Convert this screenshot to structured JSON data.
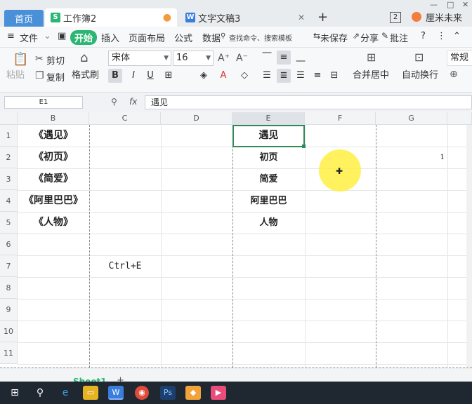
{
  "tabs": {
    "home": "首页",
    "workbook": "工作簿2",
    "workbook_icon": "S",
    "doc": "文字文稿3",
    "doc_icon": "W",
    "new_tab": "+"
  },
  "titlebar": {
    "page_count": "2",
    "user_name": "厘米未来",
    "minimize": "—",
    "restore": "□"
  },
  "menu": {
    "hamburger": "≡",
    "file": "文件",
    "start": "开始",
    "insert": "插入",
    "page_layout": "页面布局",
    "formula": "公式",
    "data": "数据",
    "search": "查找命令、搜索模板",
    "unsaved": "未保存",
    "share": "分享",
    "comment": "批注",
    "help": "?"
  },
  "ribbon": {
    "paste": "粘贴",
    "cut": "剪切",
    "copy": "复制",
    "format_painter": "格式刷",
    "font_name": "宋体",
    "font_size": "16",
    "bold": "B",
    "italic": "I",
    "underline": "U",
    "merge_center": "合并居中",
    "wrap_text": "自动换行",
    "normal": "常规"
  },
  "formula_bar": {
    "cell_ref": "E1",
    "fx": "fx",
    "content": "遇见"
  },
  "grid": {
    "columns": [
      "B",
      "C",
      "D",
      "E",
      "F",
      "G"
    ],
    "rows": [
      "1",
      "2",
      "3",
      "4",
      "5",
      "6",
      "7",
      "8",
      "9",
      "10",
      "11"
    ],
    "col_b": [
      "《遇见》",
      "《初页》",
      "《简爱》",
      "《阿里巴巴》",
      "《人物》"
    ],
    "col_e": [
      "遇见",
      "初页",
      "简爱",
      "阿里巴巴",
      "人物"
    ],
    "c7": "Ctrl+E",
    "g2": "1"
  },
  "sheets": {
    "active": "Sheet1",
    "add": "+"
  },
  "colors": {
    "accent_green": "#2bb673",
    "selection": "#2e8b57",
    "highlight": "#ffee28"
  }
}
